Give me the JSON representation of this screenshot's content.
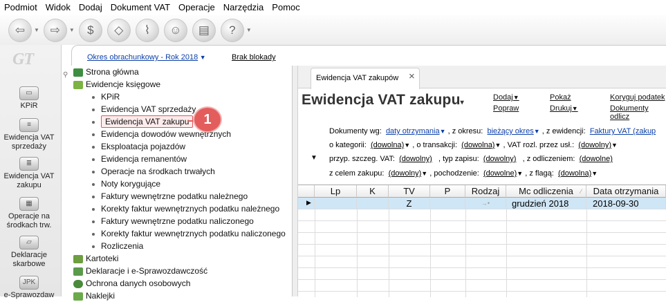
{
  "menubar": {
    "items": [
      "Podmiot",
      "Widok",
      "Dodaj",
      "Dokument VAT",
      "Operacje",
      "Narzędzia",
      "Pomoc"
    ]
  },
  "toolbar": {
    "icons": [
      "back-icon",
      "forward-icon",
      "dollar-icon",
      "eraser-icon",
      "broom-icon",
      "people-icon",
      "printer-icon",
      "help-icon"
    ]
  },
  "logo": "GT",
  "left_panel": {
    "items": [
      "KPiR",
      "Ewidencja VAT sprzedaży",
      "Ewidencja VAT zakupu",
      "Operacje na środkach trw.",
      "Deklaracje skarbowe",
      "e-Sprawozdaw"
    ]
  },
  "top_bar": {
    "period_link": "Okres obrachunkowy - Rok 2018",
    "lock_link": "Brak blokady"
  },
  "tree": {
    "items": [
      {
        "label": "Strona główna",
        "level": 0
      },
      {
        "label": "Ewidencje księgowe",
        "level": 0
      },
      {
        "label": "KPiR",
        "level": 1
      },
      {
        "label": "Ewidencja VAT sprzedaży",
        "level": 1
      },
      {
        "label": "Ewidencja VAT zakupu",
        "level": 1,
        "selected": true
      },
      {
        "label": "Ewidencja dowodów wewnętrznych",
        "level": 1
      },
      {
        "label": "Eksploatacja pojazdów",
        "level": 1
      },
      {
        "label": "Ewidencja remanentów",
        "level": 1
      },
      {
        "label": "Operacje na środkach trwałych",
        "level": 1
      },
      {
        "label": "Noty korygujące",
        "level": 1
      },
      {
        "label": "Faktury wewnętrzne podatku należnego",
        "level": 1
      },
      {
        "label": "Korekty faktur wewnętrznych podatku należnego",
        "level": 1
      },
      {
        "label": "Faktury wewnętrzne podatku naliczonego",
        "level": 1
      },
      {
        "label": "Korekty faktur wewnętrznych podatku naliczonego",
        "level": 1
      },
      {
        "label": "Rozliczenia",
        "level": 1
      },
      {
        "label": "Kartoteki",
        "level": 0
      },
      {
        "label": "Deklaracje i e-Sprawozdawczość",
        "level": 0
      },
      {
        "label": "Ochrona danych osobowych",
        "level": 0
      },
      {
        "label": "Naklejki",
        "level": 0
      }
    ]
  },
  "badge": "1",
  "tab": {
    "label": "Ewidencja VAT zakupów",
    "close": "×"
  },
  "view": {
    "title": "Ewidencja VAT zakupu",
    "actions": {
      "dodaj": "Dodaj",
      "popraw": "Popraw",
      "pokaz": "Pokaż",
      "drukuj": "Drukuj",
      "koryguj": "Koryguj podatek",
      "dokumenty": "Dokumenty odlicz"
    }
  },
  "filters": {
    "dokumenty_wg_label": "Dokumenty wg:",
    "dokumenty_wg_value": "daty otrzymania",
    "z_okresu_label": ", z okresu:",
    "z_okresu_value": "bieżący okres",
    "z_ewidencji_label": ", z ewidencji:",
    "z_ewidencji_value": "Faktury VAT (zakup",
    "kategorii_label": "o kategorii:",
    "kategorii_value": "(dowolna)",
    "transakcji_label": ", o transakcji:",
    "transakcji_value": "(dowolna)",
    "vat_rozl_label": ", VAT rozl. przez usł.:",
    "vat_rozl_value": "(dowolny)",
    "przyp_label": "przyp. szczeg. VAT:",
    "przyp_value": "(dowolny)",
    "typ_label": ", typ zapisu:",
    "typ_value": "(dowolny)",
    "odliczeniem_label": ", z odliczeniem:",
    "odliczeniem_value": "(dowolne)",
    "celem_label": "z celem zakupu:",
    "celem_value": "(dowolny)",
    "pochodzenie_label": ", pochodzenie:",
    "pochodzenie_value": "(dowolne)",
    "flaga_label": ", z flagą:",
    "flaga_value": "(dowolna)"
  },
  "grid": {
    "columns": [
      "Lp",
      "K",
      "TV",
      "P",
      "Rodzaj",
      "Mc odliczenia",
      "Data otrzymania"
    ],
    "rows": [
      [
        "",
        "",
        "Z",
        "",
        "",
        "grudzień 2018",
        "2018-09-30"
      ]
    ]
  }
}
